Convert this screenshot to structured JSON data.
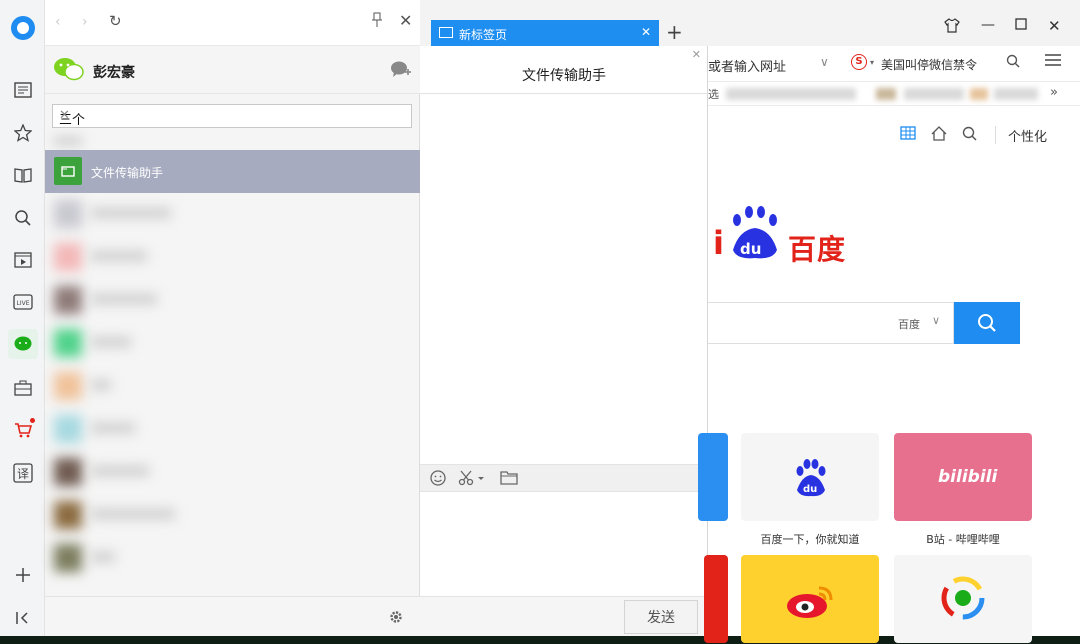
{
  "wechat": {
    "user_name": "彭宏豪",
    "search_value": "三个",
    "selected_contact": "文件传输助手",
    "blurred_items": 9
  },
  "chat": {
    "title": "文件传输助手",
    "send_label": "发送"
  },
  "browser": {
    "tab_label": "新标签页",
    "address_text": "或者输入网址",
    "news_text": "美国叫停微信禁令",
    "bookmark_first": "选",
    "customize_label": "个性化",
    "search_engine": "百度",
    "baidu_word": "百度",
    "tiles": [
      {
        "label": "百度一下，你就知道",
        "color": "#f5f5f5"
      },
      {
        "label": "B站 - 哔哩哔哩",
        "color": "#e8708f",
        "text": "bilibili"
      }
    ]
  },
  "colors": {
    "accent": "#1e8cf0",
    "baidu_red": "#e2231a",
    "wechat_green": "#1aad19",
    "selected_row": "#a6abbf"
  }
}
